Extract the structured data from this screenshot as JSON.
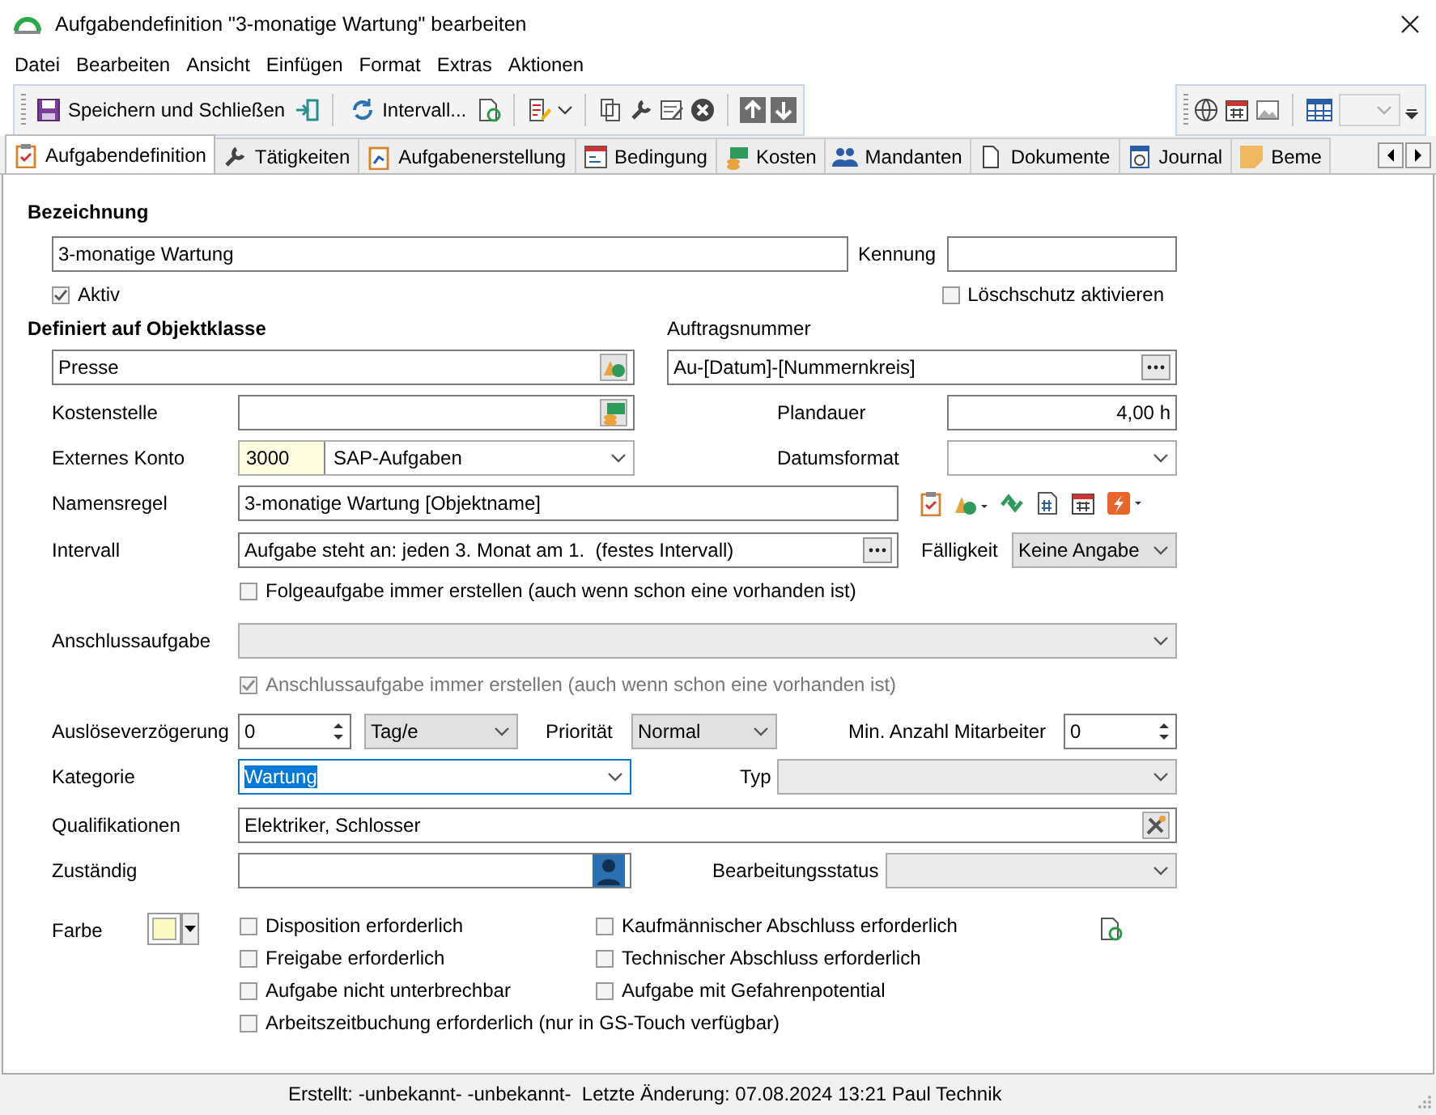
{
  "window": {
    "title": "Aufgabendefinition \"3-monatige Wartung\" bearbeiten"
  },
  "menu": [
    "Datei",
    "Bearbeiten",
    "Ansicht",
    "Einfügen",
    "Format",
    "Extras",
    "Aktionen"
  ],
  "toolbar": {
    "save": "Speichern und Schließen",
    "interval": "Intervall..."
  },
  "tabs": [
    {
      "label": "Aufgabendefinition",
      "selected": true
    },
    {
      "label": "Tätigkeiten",
      "selected": false
    },
    {
      "label": "Aufgabenerstellung",
      "selected": false
    },
    {
      "label": "Bedingung",
      "selected": false
    },
    {
      "label": "Kosten",
      "selected": false
    },
    {
      "label": "Mandanten",
      "selected": false
    },
    {
      "label": "Dokumente",
      "selected": false
    },
    {
      "label": "Journal",
      "selected": false
    },
    {
      "label": "Beme",
      "selected": false
    }
  ],
  "form": {
    "bezeichnung": {
      "label": "Bezeichnung",
      "value": "3-monatige Wartung"
    },
    "kennung": {
      "label": "Kennung"
    },
    "aktiv": {
      "label": "Aktiv",
      "checked": true
    },
    "loeschschutz": {
      "label": "Löschschutz aktivieren",
      "checked": false
    },
    "objektklasse": {
      "label": "Definiert auf Objektklasse",
      "value": "Presse"
    },
    "auftragsnummer": {
      "label": "Auftragsnummer",
      "value": "Au-[Datum]-[Nummernkreis]"
    },
    "kostenstelle": {
      "label": "Kostenstelle"
    },
    "plandauer": {
      "label": "Plandauer",
      "value": "4,00 h"
    },
    "externes_konto": {
      "label": "Externes Konto",
      "code": "3000",
      "value": "SAP-Aufgaben"
    },
    "datumsformat": {
      "label": "Datumsformat"
    },
    "namensregel": {
      "label": "Namensregel",
      "value": "3-monatige Wartung [Objektname]"
    },
    "intervall": {
      "label": "Intervall",
      "value": "Aufgabe steht an: jeden 3. Monat am 1.  (festes Intervall)"
    },
    "faelligkeit": {
      "label": "Fälligkeit",
      "value": "Keine Angabe"
    },
    "folgeaufgabe": {
      "label": "Folgeaufgabe immer erstellen (auch wenn schon eine vorhanden ist)",
      "checked": false
    },
    "anschlussaufgabe": {
      "label": "Anschlussaufgabe",
      "disabled": true
    },
    "anschluss_immer": {
      "label": "Anschlussaufgabe immer erstellen (auch wenn schon eine vorhanden ist)",
      "checked": true,
      "disabled": true
    },
    "ausloeseverzoegerung": {
      "label": "Auslöseverzögerung",
      "value": "0",
      "unit": "Tag/e"
    },
    "prioritaet": {
      "label": "Priorität",
      "value": "Normal"
    },
    "min_mitarbeiter": {
      "label": "Min. Anzahl Mitarbeiter",
      "value": "0"
    },
    "kategorie": {
      "label": "Kategorie",
      "value": "Wartung",
      "text_selected": true
    },
    "typ": {
      "label": "Typ",
      "disabled": true
    },
    "qualifikationen": {
      "label": "Qualifikationen",
      "value": "Elektriker, Schlosser"
    },
    "zustaendig": {
      "label": "Zuständig"
    },
    "bearbeitungsstatus": {
      "label": "Bearbeitungsstatus",
      "disabled": true
    },
    "farbe": {
      "label": "Farbe",
      "color": "#fdfbc4"
    },
    "flags": [
      {
        "label": "Disposition erforderlich",
        "checked": false
      },
      {
        "label": "Kaufmännischer Abschluss erforderlich",
        "checked": false
      },
      {
        "label": "Freigabe erforderlich",
        "checked": false
      },
      {
        "label": "Technischer Abschluss erforderlich",
        "checked": false
      },
      {
        "label": "Aufgabe nicht unterbrechbar",
        "checked": false
      },
      {
        "label": "Aufgabe mit Gefahrenpotential",
        "checked": false
      },
      {
        "label": "Arbeitszeitbuchung erforderlich (nur in GS-Touch verfügbar)",
        "checked": false
      }
    ]
  },
  "status_bar": "Erstellt: -unbekannt- -unbekannt-  Letzte Änderung: 07.08.2024 13:21 Paul Technik"
}
